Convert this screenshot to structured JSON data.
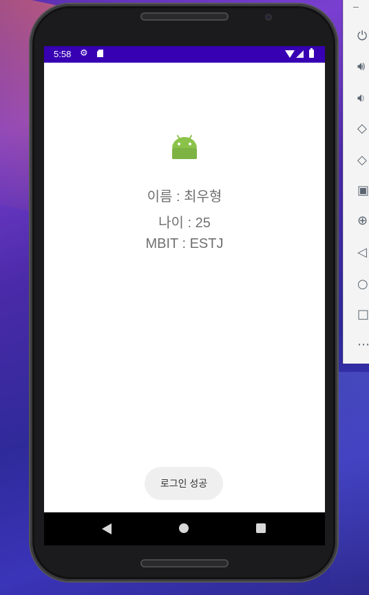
{
  "status_bar": {
    "time": "5:58",
    "icons": [
      "settings-gear-icon",
      "sd-card-icon",
      "wifi-icon",
      "cell-signal-icon",
      "battery-icon"
    ],
    "color": "#3700b3"
  },
  "app": {
    "icon": "android-robot-icon",
    "name_line": "이름 : 최우형",
    "age_line": "나이 : 25",
    "mbti_line": "MBIT : ESTJ",
    "text_color": "#707070"
  },
  "toast": {
    "message": "로그인 성공"
  },
  "nav_bar": {
    "buttons": [
      "back",
      "home",
      "recents"
    ]
  },
  "emulator_toolbar": {
    "items": [
      "minimize",
      "power",
      "volume-up",
      "volume-down",
      "rotate-left",
      "rotate-right",
      "screenshot",
      "zoom",
      "back",
      "home",
      "overview",
      "more"
    ]
  }
}
